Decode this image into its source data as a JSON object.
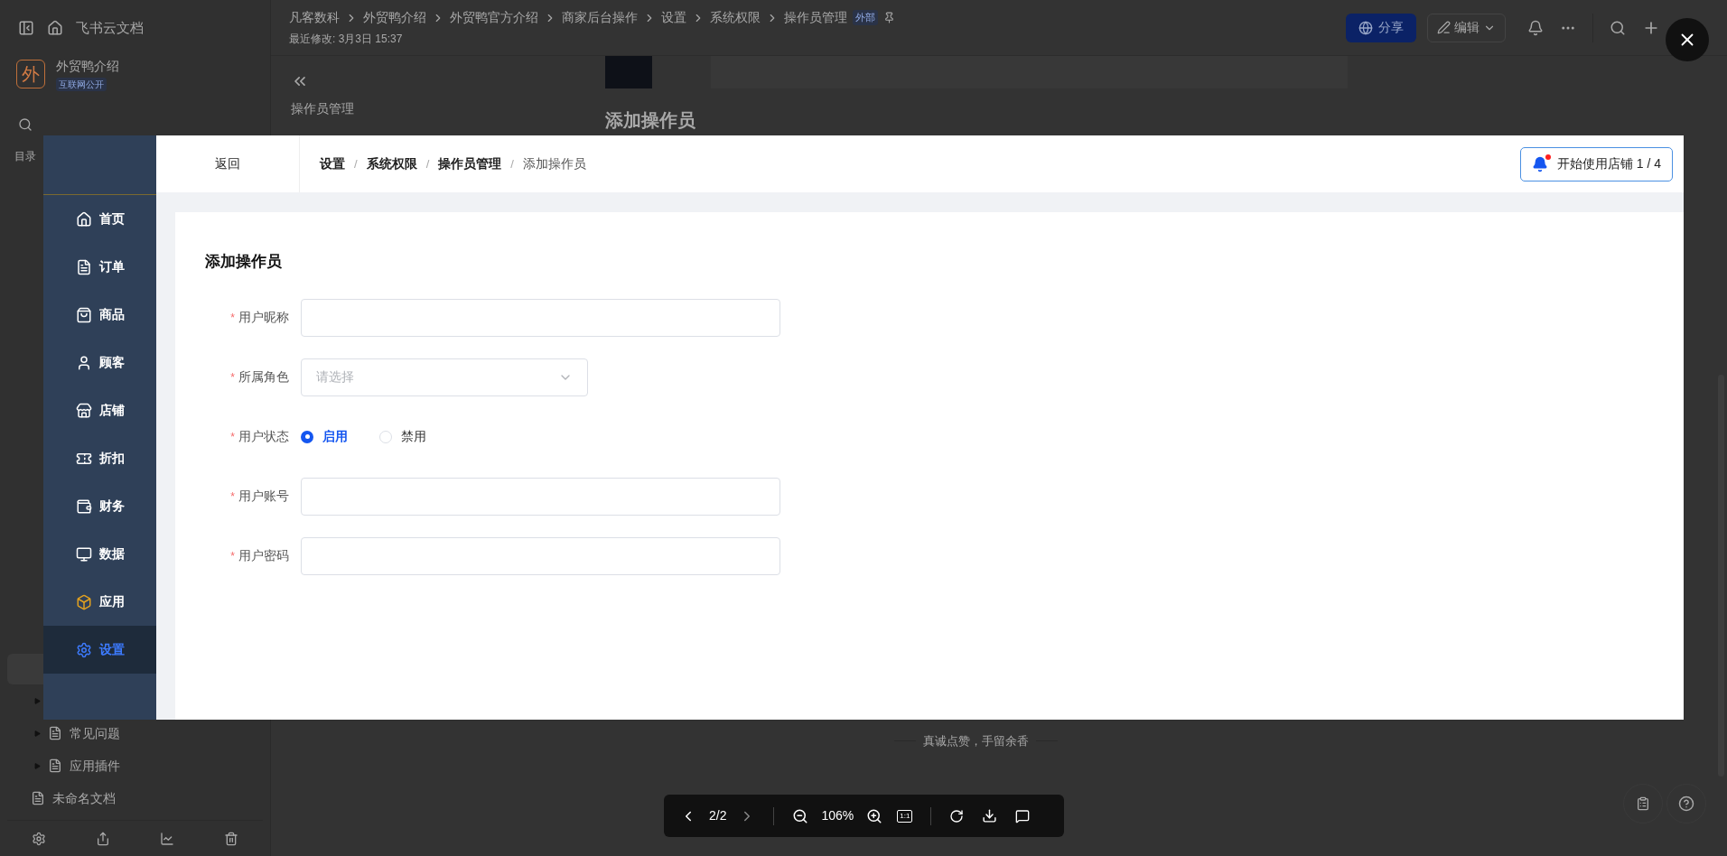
{
  "sidebar": {
    "title": "飞书云文档",
    "space": {
      "logo": "外",
      "name": "外贸鸭介绍",
      "badge": "互联网公开"
    },
    "toc_label": "目录",
    "items": [
      {
        "label": "常见问题",
        "kind": "folder"
      },
      {
        "label": "应用插件",
        "kind": "folder"
      },
      {
        "label": "未命名文档",
        "kind": "doc"
      }
    ]
  },
  "doc_header": {
    "breadcrumb": [
      "凡客数科",
      "外贸鸭介绍",
      "外贸鸭官方介绍",
      "商家后台操作",
      "设置",
      "系统权限",
      "操作员管理"
    ],
    "tag": "外部",
    "last_modified": "最近修改: 3月3日 15:37",
    "share_button": "分享",
    "edit_button": "编辑"
  },
  "doc": {
    "outline_title": "操作员管理",
    "heading": "添加操作员",
    "footer_text": "真诚点赞，手留余香"
  },
  "image_viewer": {
    "page": "2/2",
    "zoom": "106%",
    "fit_label": "1:1"
  },
  "screenshot": {
    "back": "返回",
    "breadcrumb_separator": "/",
    "breadcrumb": [
      {
        "label": "设置",
        "current": false
      },
      {
        "label": "系统权限",
        "current": false
      },
      {
        "label": "操作员管理",
        "current": false
      },
      {
        "label": "添加操作员",
        "current": true
      }
    ],
    "tour_button": "开始使用店铺 1 / 4",
    "nav": [
      {
        "label": "首页",
        "selected": false
      },
      {
        "label": "订单",
        "selected": false
      },
      {
        "label": "商品",
        "selected": false
      },
      {
        "label": "顾客",
        "selected": false
      },
      {
        "label": "店铺",
        "selected": false
      },
      {
        "label": "折扣",
        "selected": false
      },
      {
        "label": "财务",
        "selected": false
      },
      {
        "label": "数据",
        "selected": false
      },
      {
        "label": "应用",
        "selected": false
      },
      {
        "label": "设置",
        "selected": true
      }
    ],
    "form": {
      "title": "添加操作员",
      "required_mark": "*",
      "fields": [
        {
          "kind": "text",
          "label": "用户昵称",
          "required": true
        },
        {
          "kind": "select",
          "label": "所属角色",
          "required": true,
          "placeholder": "请选择"
        },
        {
          "kind": "radio",
          "label": "用户状态",
          "required": true,
          "options": [
            {
              "label": "启用",
              "selected": true
            },
            {
              "label": "禁用",
              "selected": false
            }
          ]
        },
        {
          "kind": "text",
          "label": "用户账号",
          "required": true
        },
        {
          "kind": "text",
          "label": "用户密码",
          "required": true
        }
      ]
    }
  }
}
